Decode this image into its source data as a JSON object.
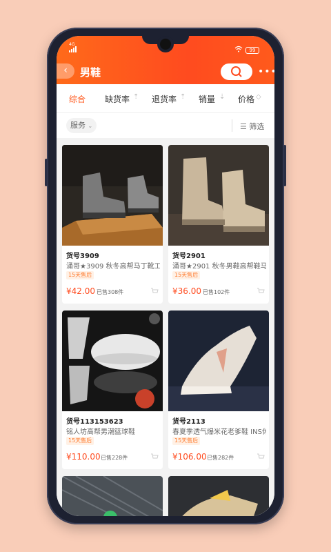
{
  "statusbar": {
    "signal": "4G",
    "battery": "99"
  },
  "header": {
    "title": "男鞋"
  },
  "sort": {
    "items": [
      {
        "label": "综合"
      },
      {
        "label": "缺货率"
      },
      {
        "label": "退货率"
      },
      {
        "label": "销量"
      },
      {
        "label": "价格"
      }
    ]
  },
  "filters": {
    "chip_label": "服务",
    "filter_label": "筛选"
  },
  "products": [
    {
      "sku": "货号3909",
      "desc": "涌哥★3909 秋冬高帮马丁靴工",
      "tag": "15天售后",
      "price": "¥42.00",
      "sold": "已售308件"
    },
    {
      "sku": "货号2901",
      "desc": "涌哥★2901 秋冬男鞋高帮鞋马",
      "tag": "15天售后",
      "price": "¥36.00",
      "sold": "已售102件"
    },
    {
      "sku": "货号113153623",
      "desc": "铭人坊高帮男潮篮球鞋",
      "tag": "15天售后",
      "price": "¥110.00",
      "sold": "已售228件"
    },
    {
      "sku": "货号2113",
      "desc": "春夏季透气爆米花老爹鞋 INS休",
      "tag": "15天售后",
      "price": "¥106.00",
      "sold": "已售282件"
    }
  ],
  "colors": {
    "accent": "#ff5a1f",
    "background": "#f9cdb8"
  }
}
